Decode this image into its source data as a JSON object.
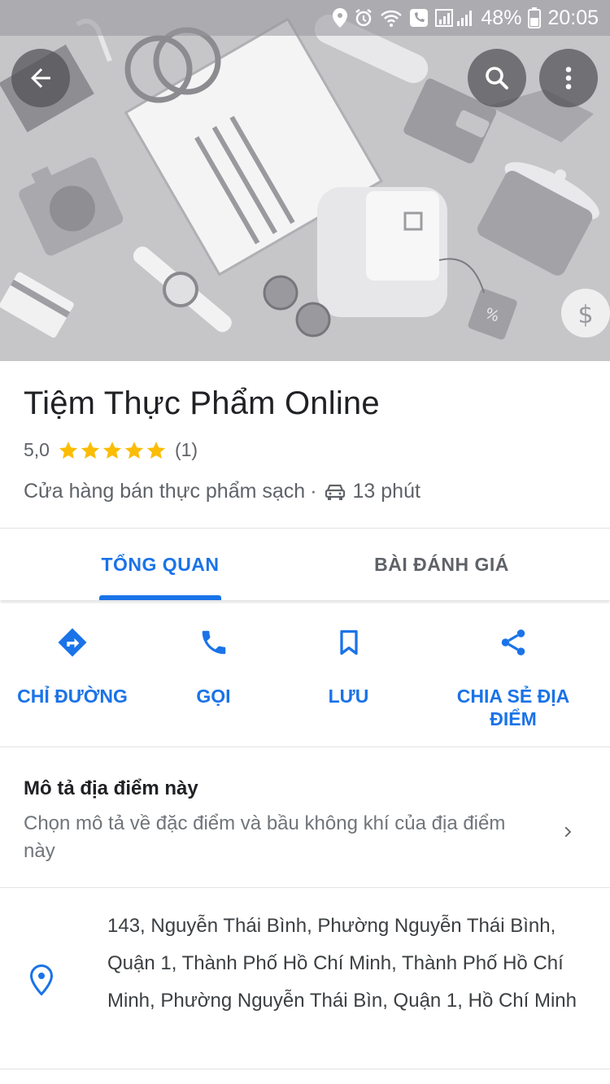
{
  "status_bar": {
    "battery_percent": "48%",
    "time": "20:05",
    "icons": [
      "location-icon",
      "alarm-icon",
      "wifi-icon",
      "call-icon",
      "signal-icon",
      "battery-icon"
    ]
  },
  "header": {
    "back_icon": "arrow-back-icon",
    "search_icon": "search-icon",
    "more_icon": "more-vert-icon"
  },
  "place": {
    "name": "Tiệm Thực Phẩm Online",
    "rating": "5,0",
    "stars": 5,
    "review_count": "(1)",
    "category": "Cửa hàng bán thực phẩm sạch",
    "separator": "·",
    "drive_time": "13 phút"
  },
  "tabs": [
    {
      "label": "TỔNG QUAN",
      "active": true
    },
    {
      "label": "BÀI ĐÁNH GIÁ",
      "active": false
    }
  ],
  "actions": [
    {
      "label": "CHỈ ĐƯỜNG",
      "icon": "directions-icon"
    },
    {
      "label": "GỌI",
      "icon": "phone-icon"
    },
    {
      "label": "LƯU",
      "icon": "bookmark-icon"
    },
    {
      "label": "CHIA SẺ ĐỊA ĐIỂM",
      "icon": "share-icon"
    }
  ],
  "describe": {
    "title": "Mô tả địa điểm này",
    "text": "Chọn mô tả về đặc điểm và bầu không khí của địa điểm này"
  },
  "address": {
    "text": "143, Nguyễn Thái Bình, Phường Nguyễn Thái Bình, Quận 1, Thành Phố Hồ Chí Minh, Thành Phố Hồ Chí Minh, Phường Nguyễn Thái Bìn, Quận 1, Hồ Chí Minh"
  },
  "colors": {
    "accent": "#1a73e8",
    "star": "#fbbc04",
    "hero_bg": "#c9c9cc"
  }
}
